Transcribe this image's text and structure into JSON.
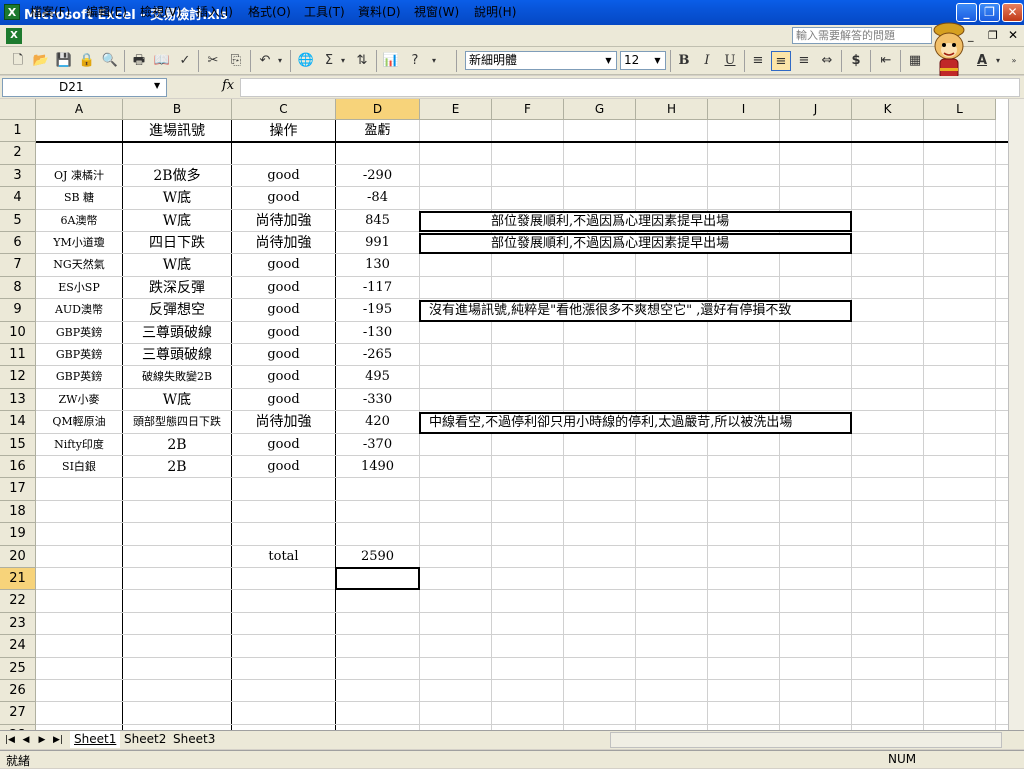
{
  "window": {
    "title": "Microsoft Excel - 交易檢討.xls"
  },
  "menu": {
    "items": [
      "檔案(F)",
      "編輯(E)",
      "檢視(V)",
      "插入(I)",
      "格式(O)",
      "工具(T)",
      "資料(D)",
      "視窗(W)",
      "說明(H)"
    ],
    "help_placeholder": "輸入需要解答的問題"
  },
  "toolbar": {
    "font": "新細明體",
    "size": "12"
  },
  "formula": {
    "name_box": "D21",
    "fx": "fx",
    "value": ""
  },
  "columns": [
    "A",
    "B",
    "C",
    "D",
    "E",
    "F",
    "G",
    "H",
    "I",
    "J",
    "K",
    "L"
  ],
  "selected_cell": "D21",
  "rows": [
    {
      "n": "1",
      "a": "",
      "b": "進場訊號",
      "c": "操作",
      "d": "盈虧"
    },
    {
      "n": "2",
      "a": "",
      "b": "",
      "c": "",
      "d": ""
    },
    {
      "n": "3",
      "a": "OJ 凍橘汁",
      "b": "2B做多",
      "c": "good",
      "d": "-290"
    },
    {
      "n": "4",
      "a": "SB 糖",
      "b": "W底",
      "c": "good",
      "d": "-84"
    },
    {
      "n": "5",
      "a": "6A澳幣",
      "b": "W底",
      "c": "尚待加強",
      "d": "845"
    },
    {
      "n": "6",
      "a": "YM小道瓊",
      "b": "四日下跌",
      "c": "尚待加強",
      "d": "991"
    },
    {
      "n": "7",
      "a": "NG天然氣",
      "b": "W底",
      "c": "good",
      "d": "130"
    },
    {
      "n": "8",
      "a": "ES小SP",
      "b": "跌深反彈",
      "c": "good",
      "d": "-117"
    },
    {
      "n": "9",
      "a": "AUD澳幣",
      "b": "反彈想空",
      "c": "good",
      "d": "-195"
    },
    {
      "n": "10",
      "a": "GBP英鎊",
      "b": "三尊頭破線",
      "c": "good",
      "d": "-130"
    },
    {
      "n": "11",
      "a": "GBP英鎊",
      "b": "三尊頭破線",
      "c": "good",
      "d": "-265"
    },
    {
      "n": "12",
      "a": "GBP英鎊",
      "b": "破線失敗變2B",
      "c": "good",
      "d": "495"
    },
    {
      "n": "13",
      "a": "ZW小麥",
      "b": "W底",
      "c": "good",
      "d": "-330"
    },
    {
      "n": "14",
      "a": "QM輕原油",
      "b": "頭部型態四日下跌",
      "c": "尚待加強",
      "d": "420"
    },
    {
      "n": "15",
      "a": "Nifty印度",
      "b": "2B",
      "c": "good",
      "d": "-370"
    },
    {
      "n": "16",
      "a": "SI白銀",
      "b": "2B",
      "c": "good",
      "d": "1490"
    },
    {
      "n": "17",
      "a": "",
      "b": "",
      "c": "",
      "d": ""
    },
    {
      "n": "18",
      "a": "",
      "b": "",
      "c": "",
      "d": ""
    },
    {
      "n": "19",
      "a": "",
      "b": "",
      "c": "",
      "d": ""
    },
    {
      "n": "20",
      "a": "",
      "b": "",
      "c": "total",
      "d": "2590"
    },
    {
      "n": "21",
      "a": "",
      "b": "",
      "c": "",
      "d": ""
    },
    {
      "n": "22",
      "a": "",
      "b": "",
      "c": "",
      "d": ""
    },
    {
      "n": "23",
      "a": "",
      "b": "",
      "c": "",
      "d": ""
    },
    {
      "n": "24",
      "a": "",
      "b": "",
      "c": "",
      "d": ""
    },
    {
      "n": "25",
      "a": "",
      "b": "",
      "c": "",
      "d": ""
    },
    {
      "n": "26",
      "a": "",
      "b": "",
      "c": "",
      "d": ""
    },
    {
      "n": "27",
      "a": "",
      "b": "",
      "c": "",
      "d": ""
    },
    {
      "n": "28",
      "a": "",
      "b": "",
      "c": "",
      "d": ""
    }
  ],
  "notes": [
    {
      "row": "5",
      "text": "部位發展順利,不過因爲心理因素提早出場"
    },
    {
      "row": "6",
      "text": "部位發展順利,不過因爲心理因素提早出場"
    },
    {
      "row": "9",
      "text": "沒有進場訊號,純粹是\"看他漲很多不爽想空它\" ,還好有停損不致"
    },
    {
      "row": "14",
      "text": "中線看空,不過停利卻只用小時線的停利,太過嚴苛,所以被洗出場"
    }
  ],
  "sheets": [
    "Sheet1",
    "Sheet2",
    "Sheet3"
  ],
  "status": {
    "ready": "就緒",
    "num": "NUM"
  }
}
